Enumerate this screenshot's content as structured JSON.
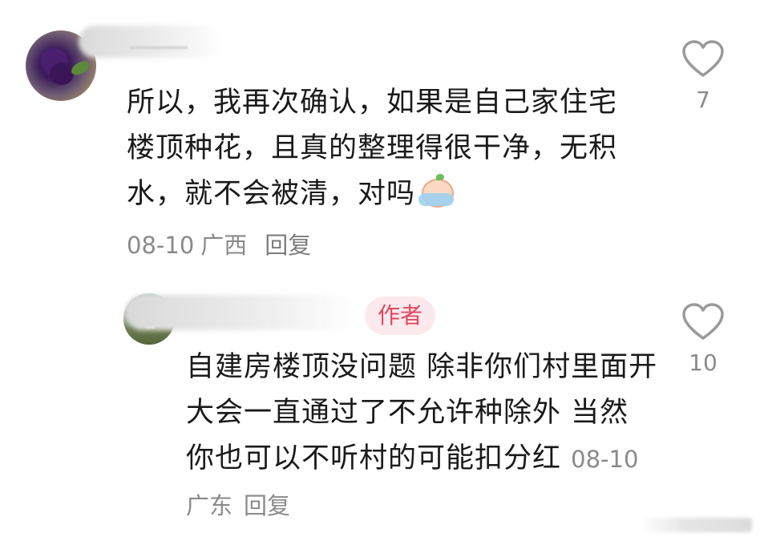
{
  "comments": [
    {
      "text": "所以，我再次确认，如果是自己家住宅楼顶种花，且真的整理得很干净，无积水，就不会被清，对吗",
      "date": "08-10",
      "location": "广西",
      "reply_label": "回复",
      "likes": "7",
      "emoji": "crying-baby-emoji"
    },
    {
      "badge": "作者",
      "text": "自建房楼顶没问题 除非你们村里面开大会一直通过了不允许种除外 当然 你也可以不听村的可能扣分红",
      "date": "08-10",
      "location": "广东",
      "reply_label": "回复",
      "likes": "10"
    }
  ],
  "icons": {
    "like": "heart-outline-icon"
  },
  "colors": {
    "text": "#1a1a1a",
    "meta": "#8a8a8a",
    "badge_bg": "#fce9ec",
    "badge_text": "#e2465f",
    "icon": "#9a9a9a"
  }
}
